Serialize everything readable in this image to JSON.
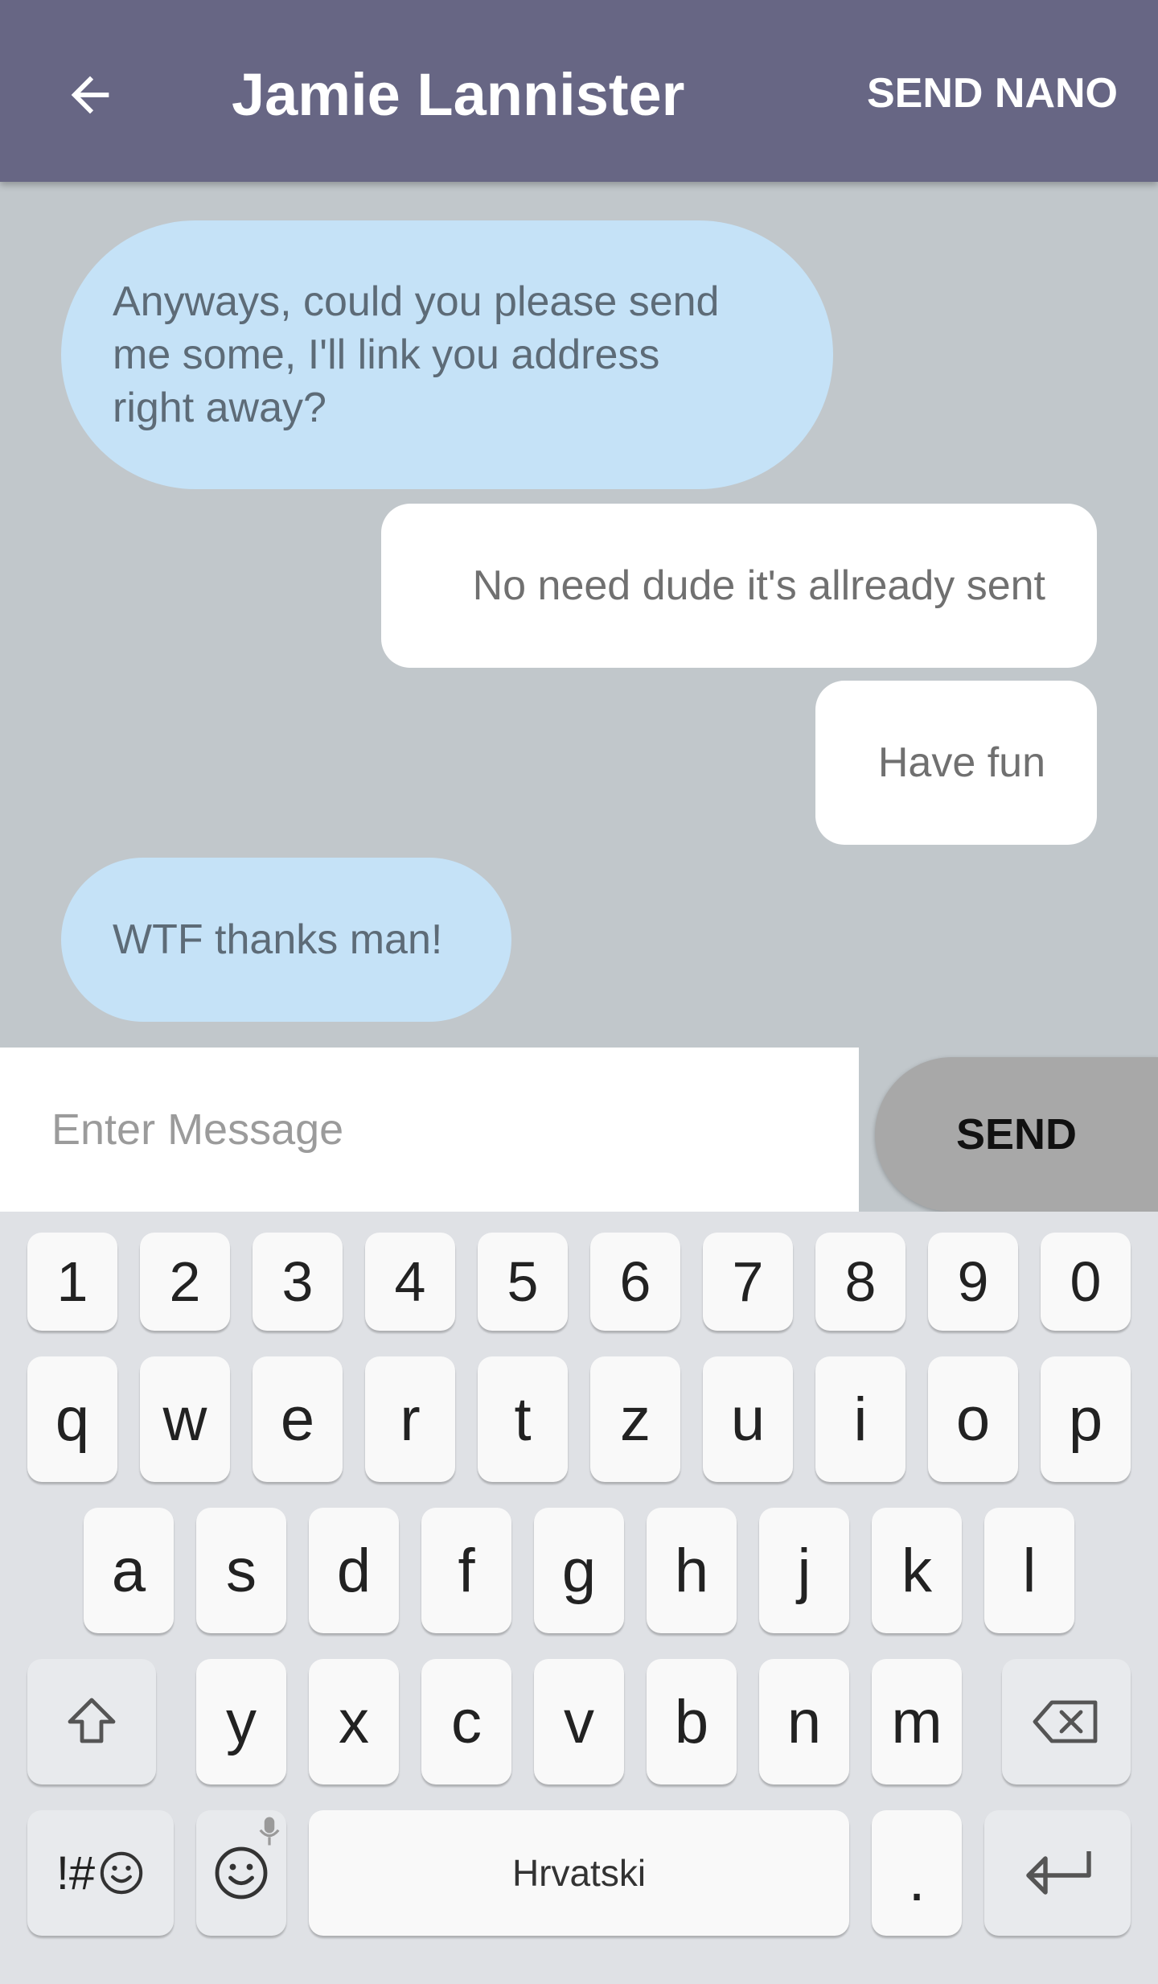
{
  "header": {
    "title": "Jamie Lannister",
    "send_nano_label": "SEND NANO",
    "back_icon": "arrow-left-icon"
  },
  "messages": [
    {
      "direction": "in",
      "lines": [
        "Anyways, could you please send",
        "me some, I'll link you address",
        "right away?"
      ]
    },
    {
      "direction": "out",
      "lines": [
        "No need dude it's allready sent"
      ]
    },
    {
      "direction": "out",
      "lines": [
        "Have fun"
      ]
    },
    {
      "direction": "in",
      "lines": [
        "WTF thanks man!"
      ]
    }
  ],
  "composer": {
    "placeholder": "Enter Message",
    "value": "",
    "send_label": "SEND"
  },
  "keyboard": {
    "number_row": [
      "1",
      "2",
      "3",
      "4",
      "5",
      "6",
      "7",
      "8",
      "9",
      "0"
    ],
    "row1": [
      "q",
      "w",
      "e",
      "r",
      "t",
      "z",
      "u",
      "i",
      "o",
      "p"
    ],
    "row2": [
      "a",
      "s",
      "d",
      "f",
      "g",
      "h",
      "j",
      "k",
      "l"
    ],
    "row3": [
      "y",
      "x",
      "c",
      "v",
      "b",
      "n",
      "m"
    ],
    "symbols_label": "!#",
    "space_label": "Hrvatski",
    "period_label": ".",
    "icons": {
      "shift": "shift-icon",
      "backspace": "backspace-icon",
      "emoji": "emoji-icon",
      "mic": "mic-icon",
      "enter": "enter-icon"
    }
  },
  "colors": {
    "appbar": "#676684",
    "chat_background": "#c1c7cb",
    "incoming_bubble": "#c5e2f7",
    "outgoing_bubble": "#ffffff",
    "send_button": "#a8a8a8",
    "keyboard_background": "#dfe1e5"
  }
}
